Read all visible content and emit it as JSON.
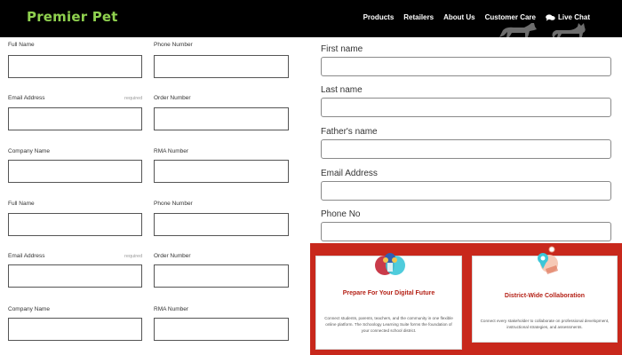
{
  "header": {
    "brand": "Premier Pet",
    "nav": [
      {
        "label": "Products"
      },
      {
        "label": "Retailers"
      },
      {
        "label": "About Us"
      },
      {
        "label": "Customer Care"
      },
      {
        "label": "Live Chat",
        "icon": "chat-bubble-icon"
      }
    ]
  },
  "left_form": {
    "fields": [
      {
        "label": "Full Name"
      },
      {
        "label": "Phone Number"
      },
      {
        "label": "Email Address",
        "required_label": "required"
      },
      {
        "label": "Order Number"
      },
      {
        "label": "Company Name"
      },
      {
        "label": "RMA Number"
      },
      {
        "label": "Full Name"
      },
      {
        "label": "Phone Number"
      },
      {
        "label": "Email Address",
        "required_label": "required"
      },
      {
        "label": "Order Number"
      },
      {
        "label": "Company Name"
      },
      {
        "label": "RMA Number"
      }
    ]
  },
  "right_form": {
    "fields": [
      {
        "label": "First name"
      },
      {
        "label": "Last name"
      },
      {
        "label": "Father's name"
      },
      {
        "label": "Email Address"
      },
      {
        "label": "Phone No"
      }
    ]
  },
  "cards": [
    {
      "title": "Prepare For Your Digital Future",
      "text": "Connect students, parents, teachers, and the community in one flexible online platform. The Schoology Learning Suite forms the foundation of your connected school district.",
      "icon": "digital-community-icon"
    },
    {
      "title": "District-Wide Collaboration",
      "text": "Connect every stakeholder to collaborate on professional development, instructional strategies, and assessments.",
      "icon": "collaboration-map-icon"
    }
  ],
  "colors": {
    "header_bg": "#000000",
    "brand": "#8fd14f",
    "promo_bg": "#c8281c",
    "card_title": "#b52217"
  }
}
